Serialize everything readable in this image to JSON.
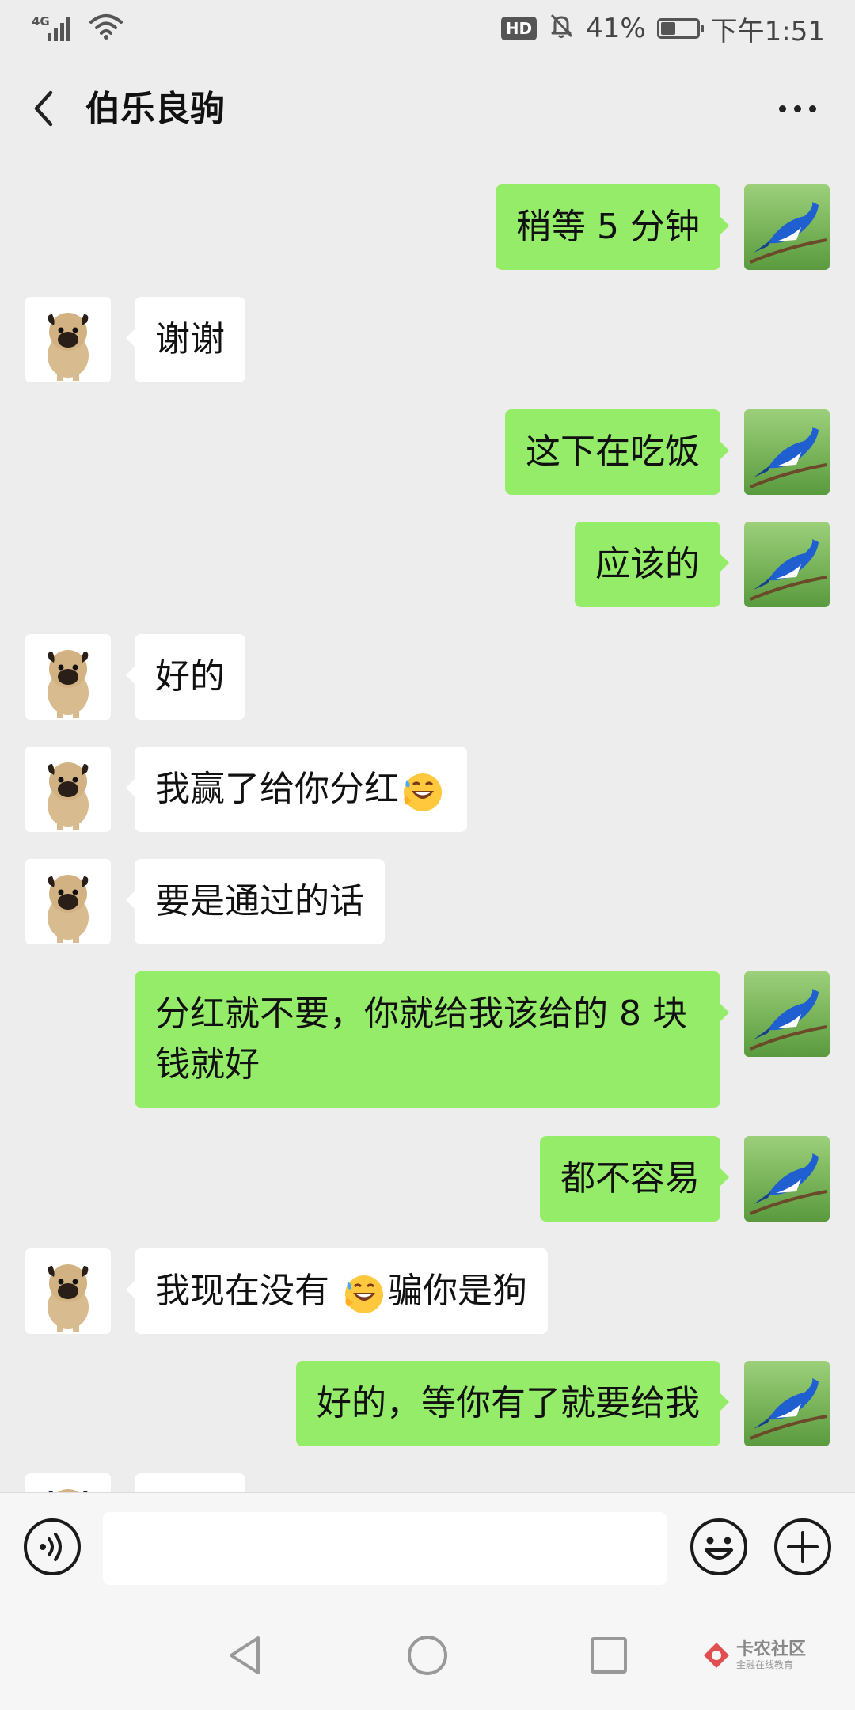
{
  "status_bar": {
    "network": "4G",
    "hd": "HD",
    "battery_text": "41%",
    "battery_level": 0.41,
    "time": "下午1:51"
  },
  "header": {
    "title": "伯乐良驹"
  },
  "messages": [
    {
      "side": "right",
      "text": "稍等 5 分钟"
    },
    {
      "side": "left",
      "text": "谢谢"
    },
    {
      "side": "right",
      "text": "这下在吃饭"
    },
    {
      "side": "right",
      "text": "应该的"
    },
    {
      "side": "left",
      "text": "好的"
    },
    {
      "side": "left",
      "text": "我赢了给你分红",
      "emoji_after": "grinning-sweat-emoji"
    },
    {
      "side": "left",
      "text": "要是通过的话"
    },
    {
      "side": "right",
      "text": "分红就不要，你就给我该给的 8 块\n钱就好"
    },
    {
      "side": "right",
      "text": "都不容易"
    },
    {
      "side": "left",
      "text_before": "我现在没有 ",
      "emoji_mid": "grinning-sweat-emoji",
      "text_after": "骗你是狗"
    },
    {
      "side": "right",
      "text": "好的，等你有了就要给我"
    }
  ],
  "input_bar": {
    "placeholder": ""
  },
  "watermark": {
    "title": "卡农社区",
    "subtitle": "金融在线教育"
  },
  "colors": {
    "sent_bubble": "#95ec69",
    "received_bubble": "#ffffff",
    "background": "#ededed"
  }
}
